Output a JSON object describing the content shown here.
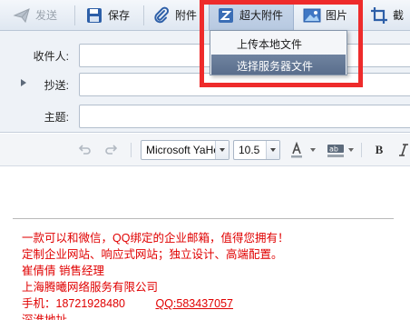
{
  "toolbar": {
    "send_label": "发送",
    "save_label": "保存",
    "attach_label": "附件",
    "super_attach_label": "超大附件",
    "picture_label": "图片",
    "screenshot_label": "截"
  },
  "headers": {
    "to_label": "收件人:",
    "cc_label": "抄送:",
    "subject_label": "主题:",
    "to_value": "",
    "cc_value": "",
    "subject_value": ""
  },
  "format": {
    "font_family": "Microsoft YaHei",
    "font_size": "10.5",
    "bold_label": "B"
  },
  "dropdown": {
    "items": [
      {
        "label": "上传本地文件",
        "hovered": false
      },
      {
        "label": "选择服务器文件",
        "hovered": true
      }
    ]
  },
  "signature": {
    "line1": "一款可以和微信，QQ绑定的企业邮箱，值得您拥有！",
    "line2": "定制企业网站、响应式网站；独立设计、高端配置。",
    "line3": "崔倩倩   销售经理",
    "line4": "上海腾曦网络服务有限公司",
    "phone_label": "手机：",
    "phone": "18721928480",
    "qq": "QQ:583437057",
    "line6": "深淮地址"
  },
  "colors": {
    "signature_text": "#e00000",
    "highlight_box": "#ee2b2b",
    "toolbar_bg": "#dfe7f1",
    "dropdown_hover": "#5a6e8c"
  },
  "icons": {
    "send": "paper-plane-icon",
    "save": "floppy-disk-icon",
    "attach": "paperclip-icon",
    "super_attach": "large-attachment-icon",
    "picture": "picture-icon",
    "screenshot": "crop-icon",
    "undo": "undo-icon",
    "redo": "redo-icon",
    "font_color": "font-color-icon",
    "highlight": "highlight-color-icon"
  }
}
